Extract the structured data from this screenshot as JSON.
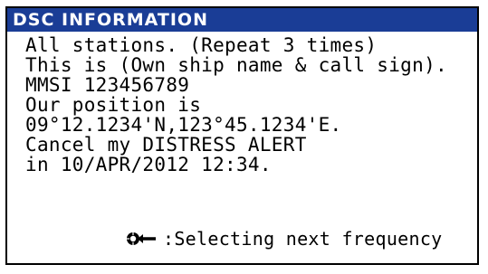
{
  "window": {
    "title": "DSC INFORMATION"
  },
  "message": {
    "lines": [
      "All stations. (Repeat 3 times)",
      "This is (Own ship name & call sign).",
      "MMSI 123456789",
      "Our position is",
      "09°12.1234'N,123°45.1234'E.",
      "Cancel my DISTRESS ALERT",
      "in 10/APR/2012 12:34."
    ]
  },
  "footer": {
    "icon": "enter-knob-icon",
    "text": ":Selecting next frequency"
  }
}
